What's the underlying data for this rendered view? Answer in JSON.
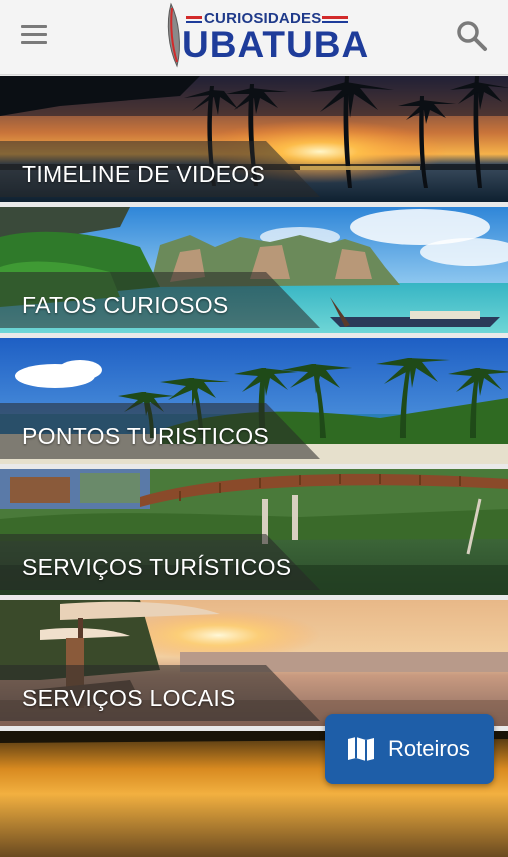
{
  "header": {
    "logo_small": "CURIOSIDADES",
    "logo_main": "UBATUBA",
    "menu_icon": "hamburger-menu-icon",
    "search_icon": "search-icon"
  },
  "cards": [
    {
      "label": "TIMELINE DE VIDEOS",
      "scene": "sunset-palms"
    },
    {
      "label": "FATOS CURIOSOS",
      "scene": "tropical-cliffs-boat"
    },
    {
      "label": "PONTOS TURISTICOS",
      "scene": "palm-beach"
    },
    {
      "label": "SERVIÇOS TURÍSTICOS",
      "scene": "wooden-bridge-river"
    },
    {
      "label": "SERVIÇOS LOCAIS",
      "scene": "beach-umbrellas-sunset"
    },
    {
      "label": "",
      "scene": "golden-sunset-beach"
    }
  ],
  "fab": {
    "label": "Roteiros",
    "icon": "map-icon"
  },
  "colors": {
    "brand_blue": "#1e3c9a",
    "brand_red": "#d22a2a",
    "fab_blue": "#1e5ea8"
  }
}
